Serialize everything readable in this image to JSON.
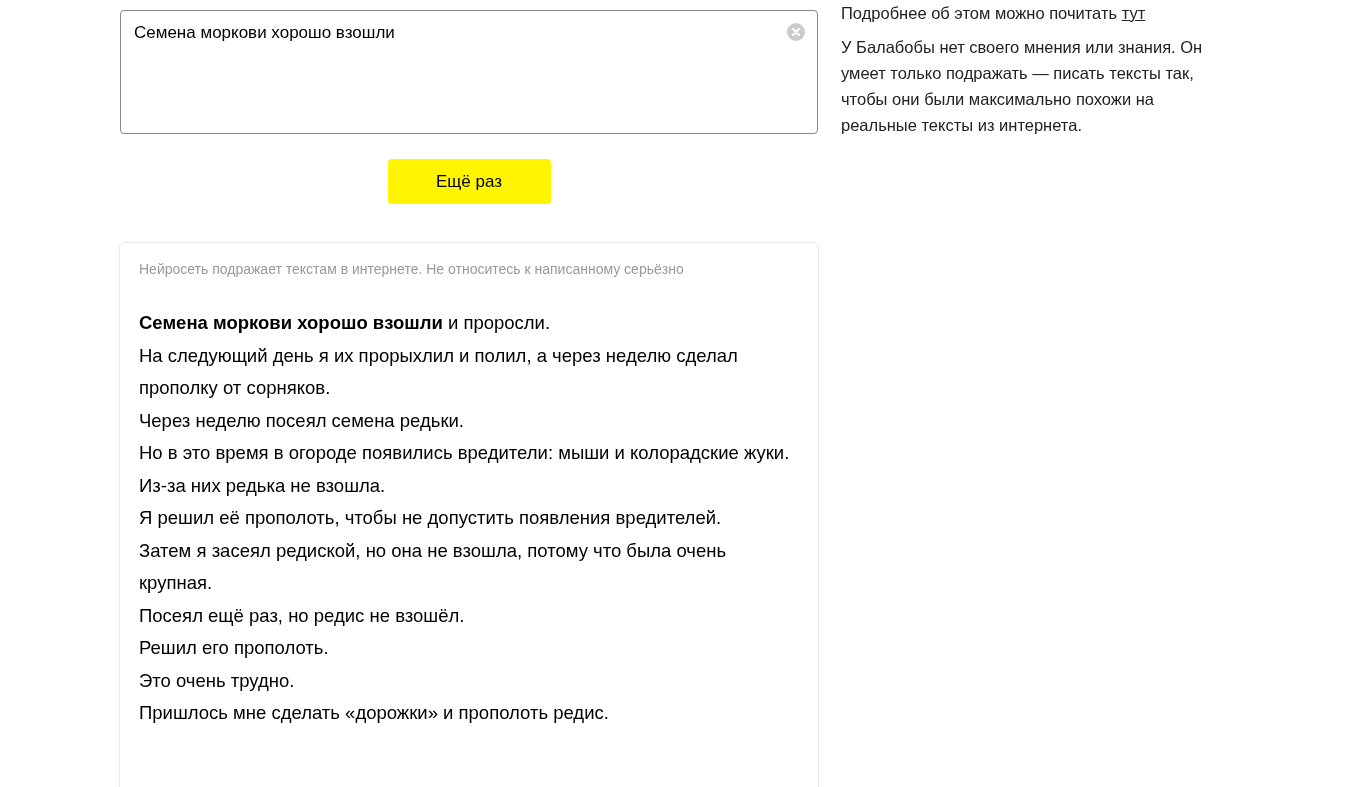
{
  "query": {
    "value": "Семена моркови хорошо взошли"
  },
  "button": "Ещё раз",
  "result": {
    "disclaimer": "Нейросеть подражает текстам в интернете. Не относитесь к написанному серьёзно",
    "lines": [
      "**Семена моркови хорошо взошли** и проросли.",
      "На следующий день я их прорыхлил и полил, а через неделю сделал прополку от сорняков.",
      "Через неделю посеял семена редьки.",
      "Но в это время в огороде появились вредители: мыши и колорадские жуки.",
      "Из-за них редька не взошла.",
      "Я решил её прополоть, чтобы не допустить появления вредителей.",
      "Затем я засеял редиской, но она не взошла, потому что была очень крупная.",
      "Посеял ещё раз, но редис не взошёл.",
      "Решил его прополоть.",
      "Это очень трудно.",
      "Пришлось мне сделать «дорожки» и прополоть редис."
    ]
  },
  "aside": {
    "more": {
      "text": "Подробнее об этом можно почитать",
      "link": "тут"
    },
    "about": "У Балабобы нет своего мнения или знания. Он умеет только подражать — писать тексты так, чтобы они были максимально похожи на реальные тексты из интернета."
  }
}
